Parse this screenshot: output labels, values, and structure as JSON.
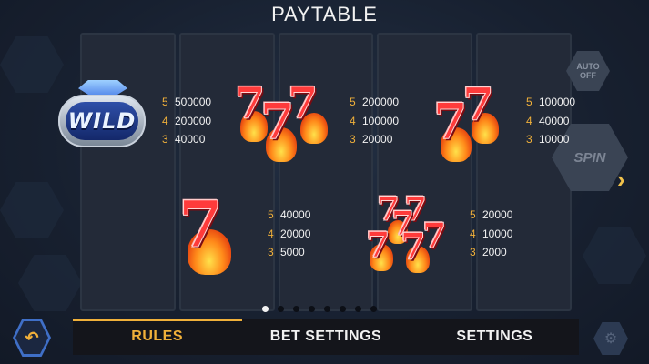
{
  "header": {
    "title": "PAYTABLE"
  },
  "controls": {
    "auto_label_1": "AUTO",
    "auto_label_2": "OFF",
    "spin_label": "SPIN",
    "next_arrow_icon": "chevron-right-icon",
    "back_icon": "undo-arrow-icon",
    "settings_icon": "gear-icon"
  },
  "symbols": [
    {
      "id": "wild",
      "label": "WILD",
      "icon": "wild-diamond-icon",
      "pays": [
        {
          "count": "5",
          "value": "500000"
        },
        {
          "count": "4",
          "value": "200000"
        },
        {
          "count": "3",
          "value": "40000"
        }
      ]
    },
    {
      "id": "triple-seven",
      "icon": "triple-flaming-seven-icon",
      "pays": [
        {
          "count": "5",
          "value": "200000"
        },
        {
          "count": "4",
          "value": "100000"
        },
        {
          "count": "3",
          "value": "20000"
        }
      ]
    },
    {
      "id": "double-seven",
      "icon": "double-flaming-seven-icon",
      "pays": [
        {
          "count": "5",
          "value": "100000"
        },
        {
          "count": "4",
          "value": "40000"
        },
        {
          "count": "3",
          "value": "10000"
        }
      ]
    },
    {
      "id": "single-seven",
      "icon": "flaming-seven-icon",
      "pays": [
        {
          "count": "5",
          "value": "40000"
        },
        {
          "count": "4",
          "value": "20000"
        },
        {
          "count": "3",
          "value": "5000"
        }
      ]
    },
    {
      "id": "any-seven",
      "icon": "mixed-flaming-sevens-icon",
      "pays": [
        {
          "count": "5",
          "value": "20000"
        },
        {
          "count": "4",
          "value": "10000"
        },
        {
          "count": "3",
          "value": "2000"
        }
      ]
    }
  ],
  "pagination": {
    "total": 8,
    "active": 1
  },
  "tabs": [
    {
      "label": "RULES",
      "active": true
    },
    {
      "label": "BET SETTINGS",
      "active": false
    },
    {
      "label": "SETTINGS",
      "active": false
    }
  ],
  "colors": {
    "accent": "#f0b03a",
    "seven_red": "#ff3b3b",
    "wild_blue": "#2e4fa8"
  }
}
